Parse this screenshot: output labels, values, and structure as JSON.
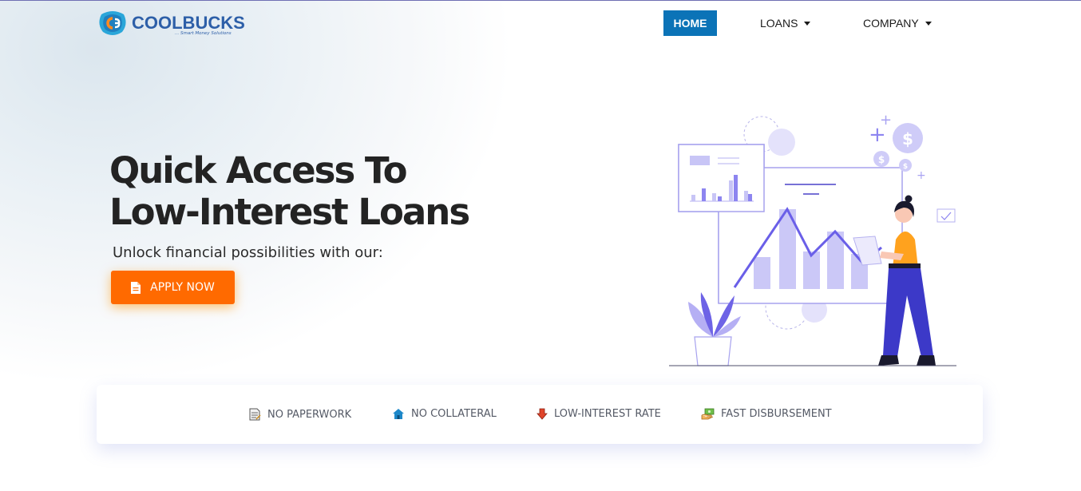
{
  "brand": {
    "name": "COOLBUCKS",
    "tagline": "... Smart Money Solutions",
    "colors": {
      "primary": "#2d5fa8",
      "accent": "#ff6a00",
      "nav_active": "#0b73b7",
      "illustration": "#7a6ef0"
    }
  },
  "nav": {
    "items": [
      {
        "label": "HOME",
        "active": true,
        "dropdown": false
      },
      {
        "label": "LOANS",
        "active": false,
        "dropdown": true
      },
      {
        "label": "COMPANY",
        "active": false,
        "dropdown": true
      }
    ]
  },
  "hero": {
    "title_line1": "Quick Access To",
    "title_line2": "Low-Interest Loans",
    "subtitle": "Unlock financial possibilities with our:",
    "cta": {
      "label": "APPLY NOW",
      "icon": "document-icon"
    }
  },
  "features": [
    {
      "label": "NO PAPERWORK",
      "icon": "paperwork-icon"
    },
    {
      "label": "NO COLLATERAL",
      "icon": "house-icon"
    },
    {
      "label": "LOW-INTEREST RATE",
      "icon": "down-arrow-icon"
    },
    {
      "label": "FAST DISBURSEMENT",
      "icon": "money-hand-icon"
    }
  ]
}
